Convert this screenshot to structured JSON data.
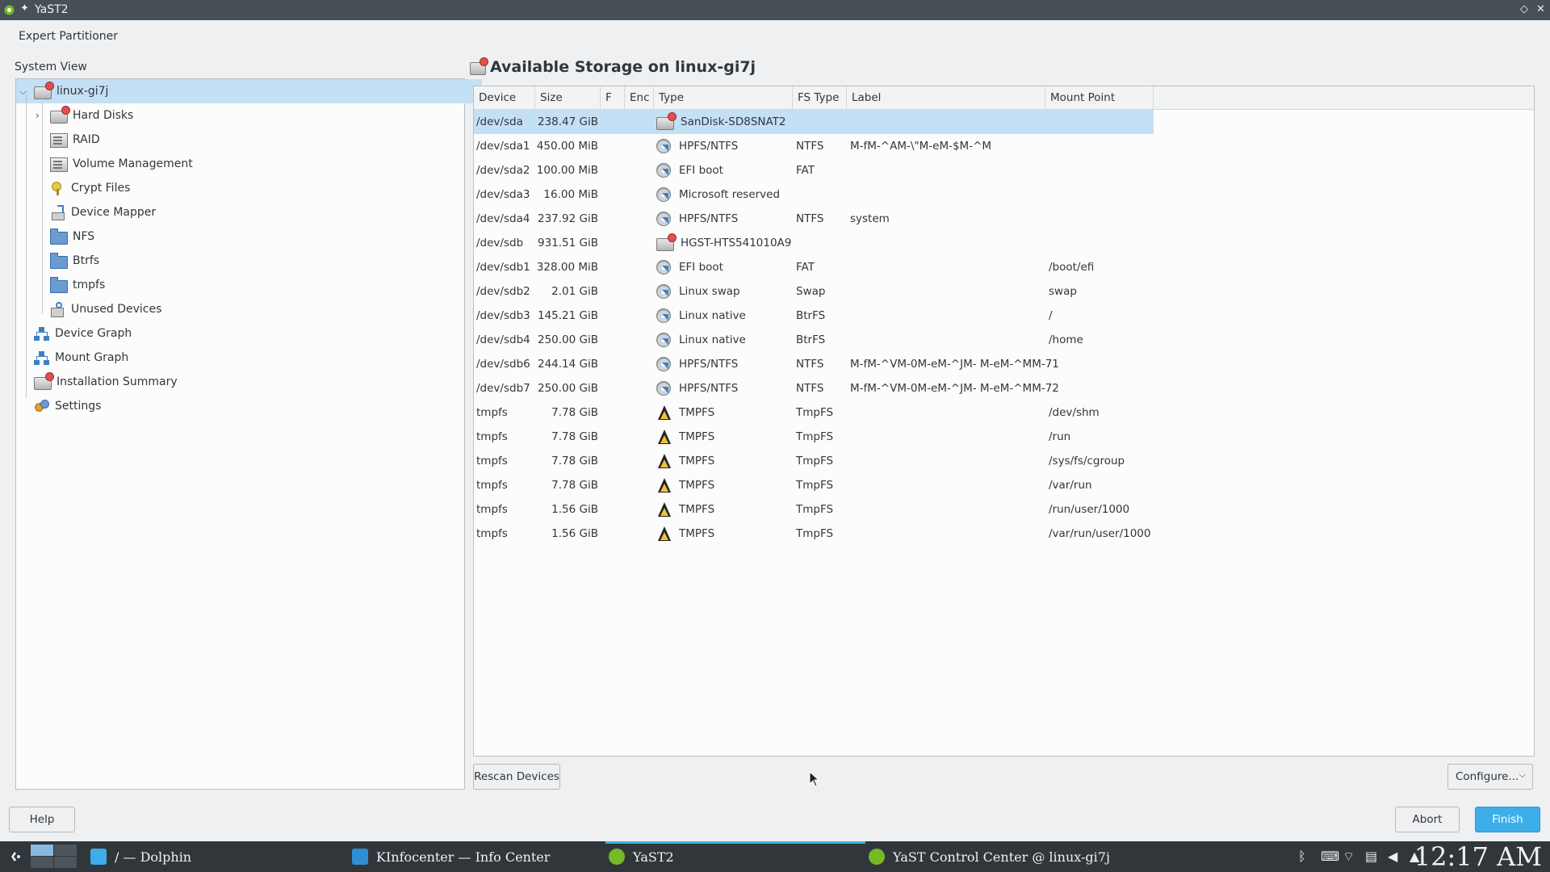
{
  "window": {
    "title": "YaST2",
    "pin_glyph": "✦",
    "restore_glyph": "◇",
    "close_glyph": "✕"
  },
  "module_title": "Expert Partitioner",
  "system_view": {
    "label": "System View",
    "tree": [
      {
        "label": "linux-gi7j",
        "icon": "computer-disk-icon",
        "level": 0,
        "expander": "⌵",
        "selected": true
      },
      {
        "label": "Hard Disks",
        "icon": "hard-disk-icon",
        "level": 1,
        "expander": "›"
      },
      {
        "label": "RAID",
        "icon": "raid-icon",
        "level": 1
      },
      {
        "label": "Volume Management",
        "icon": "volume-management-icon",
        "level": 1
      },
      {
        "label": "Crypt Files",
        "icon": "key-icon",
        "level": 1
      },
      {
        "label": "Device Mapper",
        "icon": "device-mapper-icon",
        "level": 1
      },
      {
        "label": "NFS",
        "icon": "folder-icon",
        "level": 1
      },
      {
        "label": "Btrfs",
        "icon": "folder-icon",
        "level": 1
      },
      {
        "label": "tmpfs",
        "icon": "folder-icon",
        "level": 1
      },
      {
        "label": "Unused Devices",
        "icon": "unused-devices-icon",
        "level": 1
      },
      {
        "label": "Device Graph",
        "icon": "graph-icon",
        "level": 0
      },
      {
        "label": "Mount Graph",
        "icon": "graph-icon",
        "level": 0
      },
      {
        "label": "Installation Summary",
        "icon": "summary-icon",
        "level": 0
      },
      {
        "label": "Settings",
        "icon": "settings-icon",
        "level": 0
      }
    ]
  },
  "storage": {
    "title": "Available Storage on linux-gi7j",
    "columns": [
      "Device",
      "Size",
      "F",
      "Enc",
      "Type",
      "FS Type",
      "Label",
      "Mount Point"
    ],
    "rows": [
      {
        "device": "/dev/sda",
        "size": "238.47 GiB",
        "f": "",
        "enc": "",
        "icon": "disk-icon",
        "type": "SanDisk-SD8SNAT2",
        "fs_type": "",
        "label": "",
        "mount": "",
        "selected": true
      },
      {
        "device": "/dev/sda1",
        "size": "450.00 MiB",
        "f": "",
        "enc": "",
        "icon": "partition-icon",
        "type": "HPFS/NTFS",
        "fs_type": "NTFS",
        "label": "M-fM-^AM-\\\"M-eM-$M-^M",
        "mount": ""
      },
      {
        "device": "/dev/sda2",
        "size": "100.00 MiB",
        "f": "",
        "enc": "",
        "icon": "partition-icon",
        "type": "EFI boot",
        "fs_type": "FAT",
        "label": "",
        "mount": ""
      },
      {
        "device": "/dev/sda3",
        "size": "16.00 MiB",
        "f": "",
        "enc": "",
        "icon": "partition-icon",
        "type": "Microsoft reserved",
        "fs_type": "",
        "label": "",
        "mount": ""
      },
      {
        "device": "/dev/sda4",
        "size": "237.92 GiB",
        "f": "",
        "enc": "",
        "icon": "partition-icon",
        "type": "HPFS/NTFS",
        "fs_type": "NTFS",
        "label": "system",
        "mount": ""
      },
      {
        "device": "/dev/sdb",
        "size": "931.51 GiB",
        "f": "",
        "enc": "",
        "icon": "disk-icon",
        "type": "HGST-HTS541010A9",
        "fs_type": "",
        "label": "",
        "mount": ""
      },
      {
        "device": "/dev/sdb1",
        "size": "328.00 MiB",
        "f": "",
        "enc": "",
        "icon": "partition-icon",
        "type": "EFI boot",
        "fs_type": "FAT",
        "label": "",
        "mount": "/boot/efi"
      },
      {
        "device": "/dev/sdb2",
        "size": "2.01 GiB",
        "f": "",
        "enc": "",
        "icon": "partition-icon",
        "type": "Linux swap",
        "fs_type": "Swap",
        "label": "",
        "mount": "swap"
      },
      {
        "device": "/dev/sdb3",
        "size": "145.21 GiB",
        "f": "",
        "enc": "",
        "icon": "partition-icon",
        "type": "Linux native",
        "fs_type": "BtrFS",
        "label": "",
        "mount": "/"
      },
      {
        "device": "/dev/sdb4",
        "size": "250.00 GiB",
        "f": "",
        "enc": "",
        "icon": "partition-icon",
        "type": "Linux native",
        "fs_type": "BtrFS",
        "label": "",
        "mount": "/home"
      },
      {
        "device": "/dev/sdb6",
        "size": "244.14 GiB",
        "f": "",
        "enc": "",
        "icon": "partition-icon",
        "type": "HPFS/NTFS",
        "fs_type": "NTFS",
        "label": "M-fM-^VM-0M-eM-^JM- M-eM-^MM-71",
        "mount": ""
      },
      {
        "device": "/dev/sdb7",
        "size": "250.00 GiB",
        "f": "",
        "enc": "",
        "icon": "partition-icon",
        "type": "HPFS/NTFS",
        "fs_type": "NTFS",
        "label": "M-fM-^VM-0M-eM-^JM- M-eM-^MM-72",
        "mount": ""
      },
      {
        "device": "tmpfs",
        "size": "7.78 GiB",
        "f": "",
        "enc": "",
        "icon": "tmpfs-icon",
        "type": "TMPFS",
        "fs_type": "TmpFS",
        "label": "",
        "mount": "/dev/shm"
      },
      {
        "device": "tmpfs",
        "size": "7.78 GiB",
        "f": "",
        "enc": "",
        "icon": "tmpfs-icon",
        "type": "TMPFS",
        "fs_type": "TmpFS",
        "label": "",
        "mount": "/run"
      },
      {
        "device": "tmpfs",
        "size": "7.78 GiB",
        "f": "",
        "enc": "",
        "icon": "tmpfs-icon",
        "type": "TMPFS",
        "fs_type": "TmpFS",
        "label": "",
        "mount": "/sys/fs/cgroup"
      },
      {
        "device": "tmpfs",
        "size": "7.78 GiB",
        "f": "",
        "enc": "",
        "icon": "tmpfs-icon",
        "type": "TMPFS",
        "fs_type": "TmpFS",
        "label": "",
        "mount": "/var/run"
      },
      {
        "device": "tmpfs",
        "size": "1.56 GiB",
        "f": "",
        "enc": "",
        "icon": "tmpfs-icon",
        "type": "TMPFS",
        "fs_type": "TmpFS",
        "label": "",
        "mount": "/run/user/1000"
      },
      {
        "device": "tmpfs",
        "size": "1.56 GiB",
        "f": "",
        "enc": "",
        "icon": "tmpfs-icon",
        "type": "TMPFS",
        "fs_type": "TmpFS",
        "label": "",
        "mount": "/var/run/user/1000"
      }
    ]
  },
  "buttons": {
    "rescan": "Rescan Devices",
    "configure": "Configure...",
    "configure_caret": "⌵",
    "help": "Help",
    "abort": "Abort",
    "finish": "Finish"
  },
  "taskbar": {
    "tasks": [
      {
        "label": "/ — Dolphin",
        "icon": "dolphin-icon",
        "color": "#3daee9"
      },
      {
        "label": "KInfocenter — Info Center",
        "icon": "info-center-icon",
        "color": "#2f8fd6"
      },
      {
        "label": "YaST2",
        "icon": "yast-icon",
        "color": "#73ba25",
        "active": true
      },
      {
        "label": "YaST Control Center @ linux-gi7j",
        "icon": "yast-icon",
        "color": "#73ba25"
      }
    ],
    "tray": [
      "bluetooth-icon",
      "keyboard-icon",
      "network-icon",
      "clipboard-icon",
      "volume-icon",
      "expand-tray-icon"
    ],
    "tray_glyphs": [
      "ᛒ",
      "⌨",
      "⌔",
      "▤",
      "◀",
      "▲"
    ],
    "clock": "12:17 AM"
  },
  "colors": {
    "accent": "#3daee9",
    "selection": "#c4e0f5",
    "titlebar": "#475057",
    "taskbar": "#31363b"
  }
}
